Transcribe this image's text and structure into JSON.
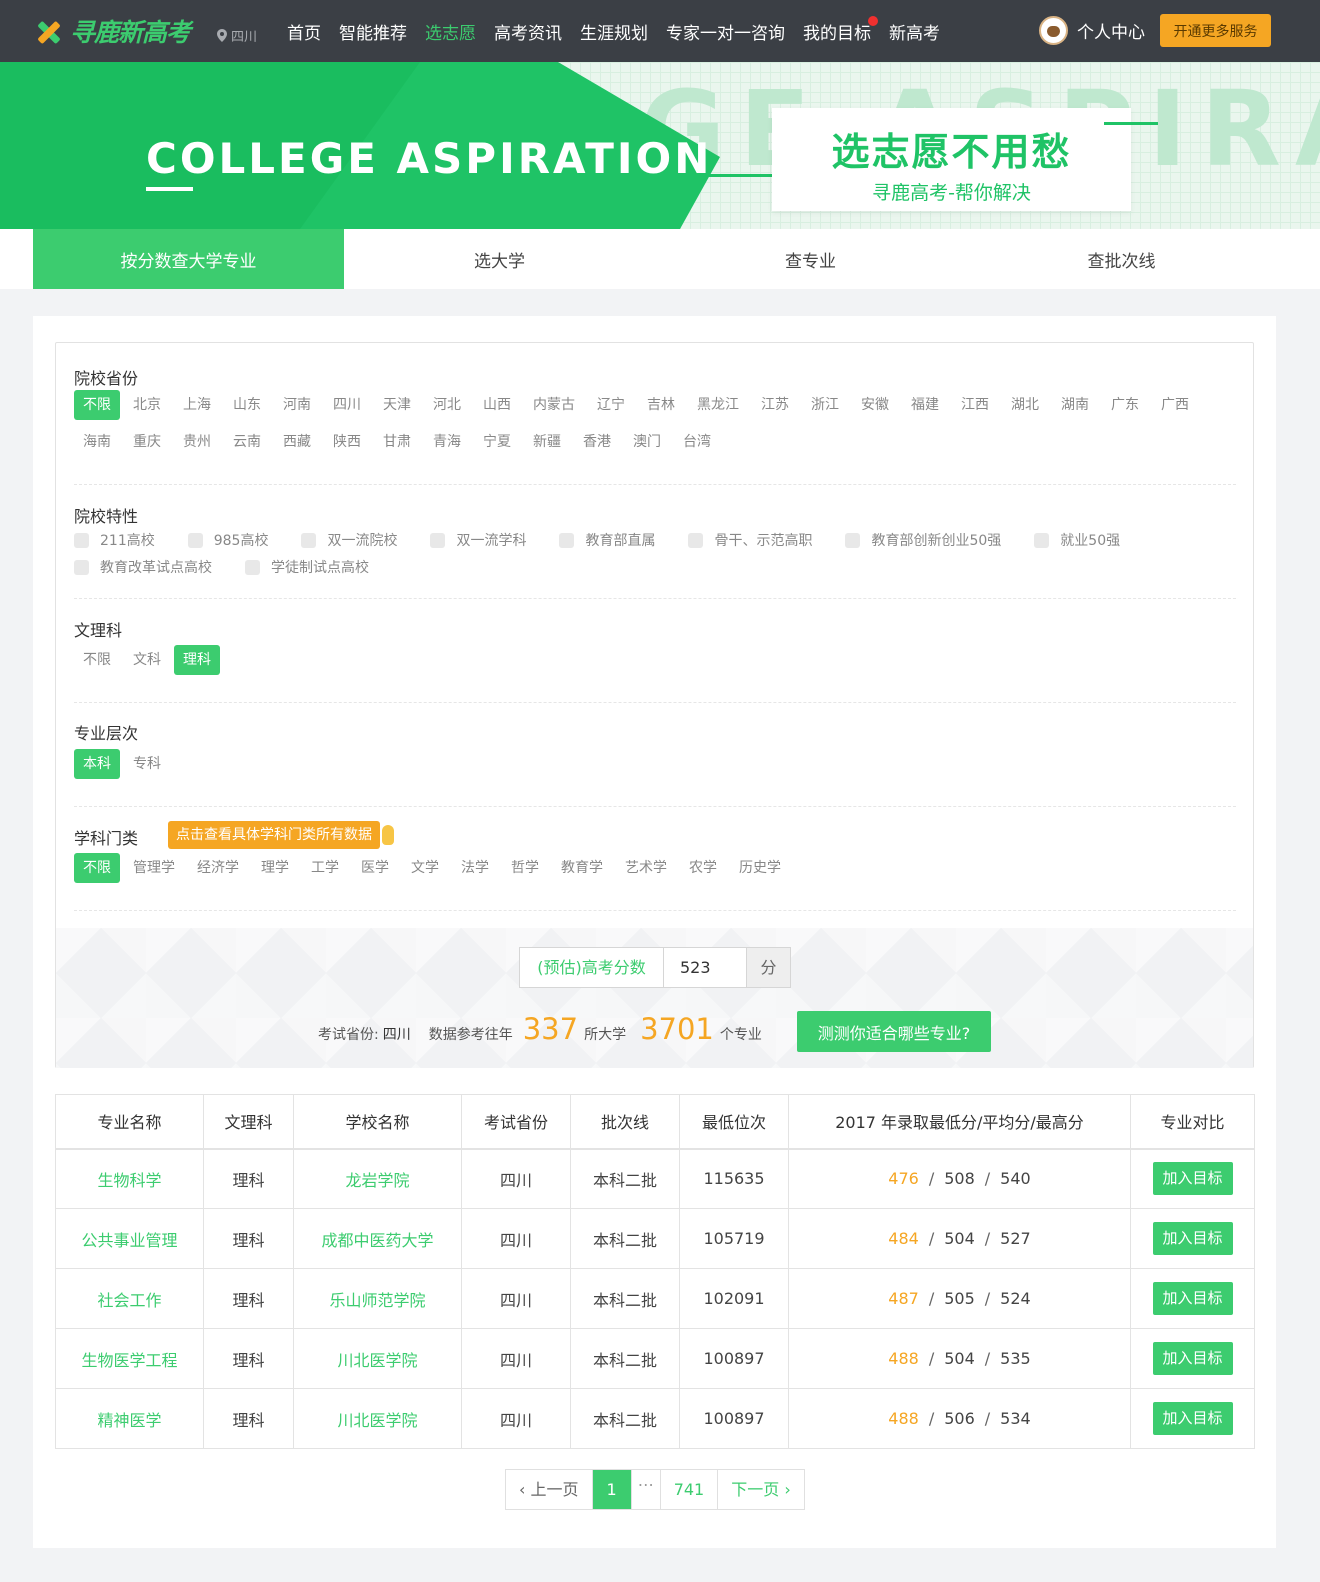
{
  "header": {
    "logo_text": "寻鹿新高考",
    "location": "四川",
    "nav": [
      "首页",
      "智能推荐",
      "选志愿",
      "高考资讯",
      "生涯规划",
      "专家一对一咨询",
      "我的目标",
      "新高考"
    ],
    "active_nav": "选志愿",
    "user_label": "个人中心",
    "vip_button": "开通更多服务"
  },
  "banner": {
    "english_title": "COLLEGE ASPIRATION",
    "bg_word": "GE ASPIRAT",
    "slogan_main": "选志愿不用愁",
    "slogan_sub": "寻鹿高考-帮你解决"
  },
  "tabs": [
    "按分数查大学专业",
    "选大学",
    "查专业",
    "查批次线"
  ],
  "filters": {
    "province": {
      "title": "院校省份",
      "options": [
        "不限",
        "北京",
        "上海",
        "山东",
        "河南",
        "四川",
        "天津",
        "河北",
        "山西",
        "内蒙古",
        "辽宁",
        "吉林",
        "黑龙江",
        "江苏",
        "浙江",
        "安徽",
        "福建",
        "江西",
        "湖北",
        "湖南",
        "广东",
        "广西",
        "海南",
        "重庆",
        "贵州",
        "云南",
        "西藏",
        "陕西",
        "甘肃",
        "青海",
        "宁夏",
        "新疆",
        "香港",
        "澳门",
        "台湾"
      ],
      "selected": "不限"
    },
    "features": {
      "title": "院校特性",
      "options": [
        "211高校",
        "985高校",
        "双一流院校",
        "双一流学科",
        "教育部直属",
        "骨干、示范高职",
        "教育部创新创业50强",
        "就业50强",
        "教育改革试点高校",
        "学徒制试点高校"
      ]
    },
    "subject_type": {
      "title": "文理科",
      "options": [
        "不限",
        "文科",
        "理科"
      ],
      "selected": "理科"
    },
    "level": {
      "title": "专业层次",
      "options": [
        "本科",
        "专科"
      ],
      "selected": "本科"
    },
    "discipline": {
      "title": "学科门类",
      "hint_button": "点击查看具体学科门类所有数据",
      "options": [
        "不限",
        "管理学",
        "经济学",
        "理学",
        "工学",
        "医学",
        "文学",
        "法学",
        "哲学",
        "教育学",
        "艺术学",
        "农学",
        "历史学"
      ],
      "selected": "不限"
    }
  },
  "score": {
    "label": "(预估)高考分数",
    "value": "523",
    "unit": "分",
    "exam_province_label": "考试省份:",
    "exam_province": "四川",
    "ref_label": "数据参考往年",
    "uni_count": "337",
    "uni_unit": "所大学",
    "major_count": "3701",
    "major_unit": "个专业",
    "test_button": "测测你适合哪些专业?"
  },
  "table": {
    "headers": [
      "专业名称",
      "文理科",
      "学校名称",
      "考试省份",
      "批次线",
      "最低位次",
      "2017 年录取最低分/平均分/最高分",
      "专业对比"
    ],
    "rows": [
      {
        "major": "生物科学",
        "type": "理科",
        "school": "龙岩学院",
        "province": "四川",
        "batch": "本科二批",
        "rank": "115635",
        "min": "476",
        "avg": "508",
        "max": "540",
        "action": "加入目标"
      },
      {
        "major": "公共事业管理",
        "type": "理科",
        "school": "成都中医药大学",
        "province": "四川",
        "batch": "本科二批",
        "rank": "105719",
        "min": "484",
        "avg": "504",
        "max": "527",
        "action": "加入目标"
      },
      {
        "major": "社会工作",
        "type": "理科",
        "school": "乐山师范学院",
        "province": "四川",
        "batch": "本科二批",
        "rank": "102091",
        "min": "487",
        "avg": "505",
        "max": "524",
        "action": "加入目标"
      },
      {
        "major": "生物医学工程",
        "type": "理科",
        "school": "川北医学院",
        "province": "四川",
        "batch": "本科二批",
        "rank": "100897",
        "min": "488",
        "avg": "504",
        "max": "535",
        "action": "加入目标"
      },
      {
        "major": "精神医学",
        "type": "理科",
        "school": "川北医学院",
        "province": "四川",
        "batch": "本科二批",
        "rank": "100897",
        "min": "488",
        "avg": "506",
        "max": "534",
        "action": "加入目标"
      }
    ]
  },
  "pagination": {
    "prev": "上一页",
    "current": "1",
    "ellipsis": "…",
    "last": "741",
    "next": "下一页"
  },
  "colors": {
    "accent": "#3ccc6f",
    "orange": "#f5a623",
    "nav_bg": "#3b3f45"
  }
}
